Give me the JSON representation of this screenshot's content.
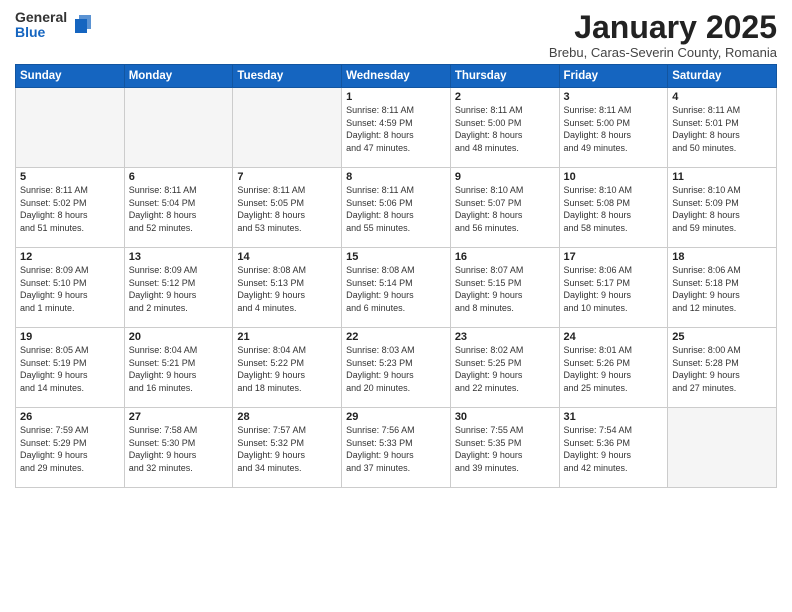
{
  "logo": {
    "general": "General",
    "blue": "Blue"
  },
  "title": "January 2025",
  "subtitle": "Brebu, Caras-Severin County, Romania",
  "headers": [
    "Sunday",
    "Monday",
    "Tuesday",
    "Wednesday",
    "Thursday",
    "Friday",
    "Saturday"
  ],
  "weeks": [
    [
      {
        "num": "",
        "info": ""
      },
      {
        "num": "",
        "info": ""
      },
      {
        "num": "",
        "info": ""
      },
      {
        "num": "1",
        "info": "Sunrise: 8:11 AM\nSunset: 4:59 PM\nDaylight: 8 hours\nand 47 minutes."
      },
      {
        "num": "2",
        "info": "Sunrise: 8:11 AM\nSunset: 5:00 PM\nDaylight: 8 hours\nand 48 minutes."
      },
      {
        "num": "3",
        "info": "Sunrise: 8:11 AM\nSunset: 5:00 PM\nDaylight: 8 hours\nand 49 minutes."
      },
      {
        "num": "4",
        "info": "Sunrise: 8:11 AM\nSunset: 5:01 PM\nDaylight: 8 hours\nand 50 minutes."
      }
    ],
    [
      {
        "num": "5",
        "info": "Sunrise: 8:11 AM\nSunset: 5:02 PM\nDaylight: 8 hours\nand 51 minutes."
      },
      {
        "num": "6",
        "info": "Sunrise: 8:11 AM\nSunset: 5:04 PM\nDaylight: 8 hours\nand 52 minutes."
      },
      {
        "num": "7",
        "info": "Sunrise: 8:11 AM\nSunset: 5:05 PM\nDaylight: 8 hours\nand 53 minutes."
      },
      {
        "num": "8",
        "info": "Sunrise: 8:11 AM\nSunset: 5:06 PM\nDaylight: 8 hours\nand 55 minutes."
      },
      {
        "num": "9",
        "info": "Sunrise: 8:10 AM\nSunset: 5:07 PM\nDaylight: 8 hours\nand 56 minutes."
      },
      {
        "num": "10",
        "info": "Sunrise: 8:10 AM\nSunset: 5:08 PM\nDaylight: 8 hours\nand 58 minutes."
      },
      {
        "num": "11",
        "info": "Sunrise: 8:10 AM\nSunset: 5:09 PM\nDaylight: 8 hours\nand 59 minutes."
      }
    ],
    [
      {
        "num": "12",
        "info": "Sunrise: 8:09 AM\nSunset: 5:10 PM\nDaylight: 9 hours\nand 1 minute."
      },
      {
        "num": "13",
        "info": "Sunrise: 8:09 AM\nSunset: 5:12 PM\nDaylight: 9 hours\nand 2 minutes."
      },
      {
        "num": "14",
        "info": "Sunrise: 8:08 AM\nSunset: 5:13 PM\nDaylight: 9 hours\nand 4 minutes."
      },
      {
        "num": "15",
        "info": "Sunrise: 8:08 AM\nSunset: 5:14 PM\nDaylight: 9 hours\nand 6 minutes."
      },
      {
        "num": "16",
        "info": "Sunrise: 8:07 AM\nSunset: 5:15 PM\nDaylight: 9 hours\nand 8 minutes."
      },
      {
        "num": "17",
        "info": "Sunrise: 8:06 AM\nSunset: 5:17 PM\nDaylight: 9 hours\nand 10 minutes."
      },
      {
        "num": "18",
        "info": "Sunrise: 8:06 AM\nSunset: 5:18 PM\nDaylight: 9 hours\nand 12 minutes."
      }
    ],
    [
      {
        "num": "19",
        "info": "Sunrise: 8:05 AM\nSunset: 5:19 PM\nDaylight: 9 hours\nand 14 minutes."
      },
      {
        "num": "20",
        "info": "Sunrise: 8:04 AM\nSunset: 5:21 PM\nDaylight: 9 hours\nand 16 minutes."
      },
      {
        "num": "21",
        "info": "Sunrise: 8:04 AM\nSunset: 5:22 PM\nDaylight: 9 hours\nand 18 minutes."
      },
      {
        "num": "22",
        "info": "Sunrise: 8:03 AM\nSunset: 5:23 PM\nDaylight: 9 hours\nand 20 minutes."
      },
      {
        "num": "23",
        "info": "Sunrise: 8:02 AM\nSunset: 5:25 PM\nDaylight: 9 hours\nand 22 minutes."
      },
      {
        "num": "24",
        "info": "Sunrise: 8:01 AM\nSunset: 5:26 PM\nDaylight: 9 hours\nand 25 minutes."
      },
      {
        "num": "25",
        "info": "Sunrise: 8:00 AM\nSunset: 5:28 PM\nDaylight: 9 hours\nand 27 minutes."
      }
    ],
    [
      {
        "num": "26",
        "info": "Sunrise: 7:59 AM\nSunset: 5:29 PM\nDaylight: 9 hours\nand 29 minutes."
      },
      {
        "num": "27",
        "info": "Sunrise: 7:58 AM\nSunset: 5:30 PM\nDaylight: 9 hours\nand 32 minutes."
      },
      {
        "num": "28",
        "info": "Sunrise: 7:57 AM\nSunset: 5:32 PM\nDaylight: 9 hours\nand 34 minutes."
      },
      {
        "num": "29",
        "info": "Sunrise: 7:56 AM\nSunset: 5:33 PM\nDaylight: 9 hours\nand 37 minutes."
      },
      {
        "num": "30",
        "info": "Sunrise: 7:55 AM\nSunset: 5:35 PM\nDaylight: 9 hours\nand 39 minutes."
      },
      {
        "num": "31",
        "info": "Sunrise: 7:54 AM\nSunset: 5:36 PM\nDaylight: 9 hours\nand 42 minutes."
      },
      {
        "num": "",
        "info": ""
      }
    ]
  ]
}
